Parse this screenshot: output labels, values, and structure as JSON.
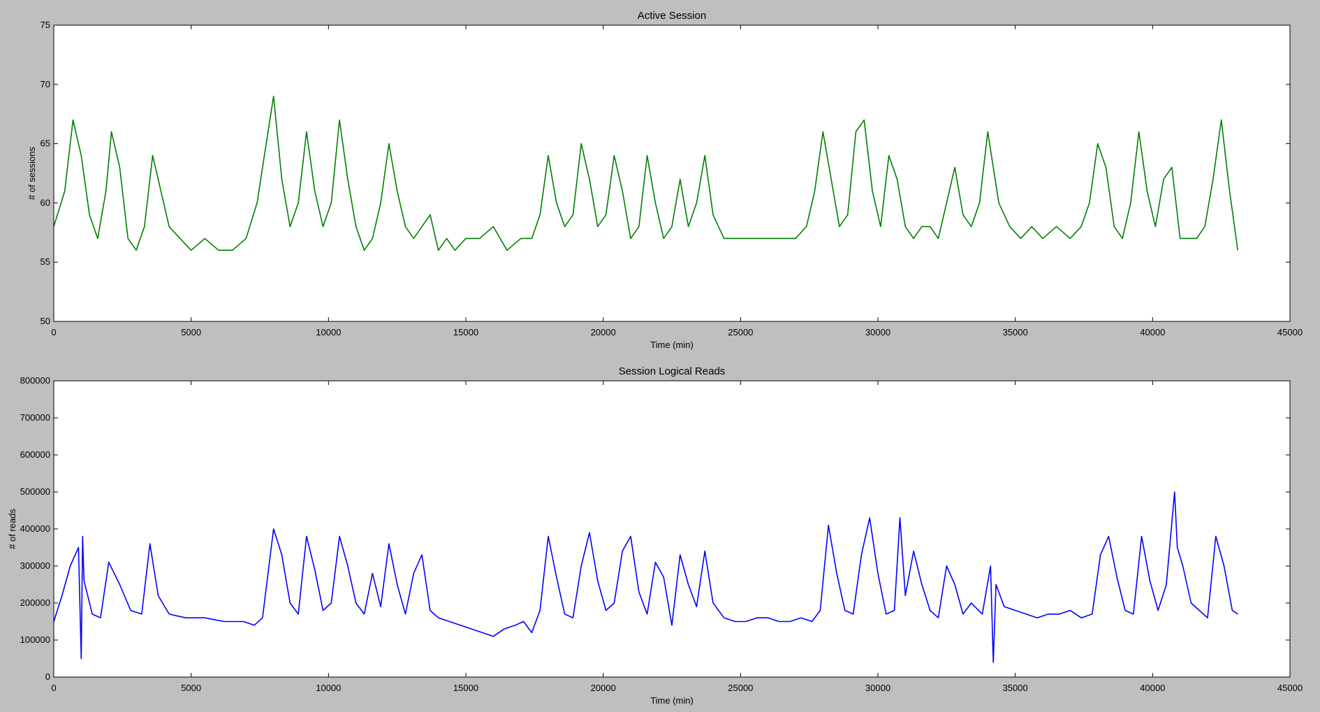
{
  "chart_data": [
    {
      "type": "line",
      "title": "Active Session",
      "xlabel": "Time (min)",
      "ylabel": "# of sessions",
      "xlim": [
        0,
        45000
      ],
      "ylim": [
        50,
        75
      ],
      "xticks": [
        "0",
        "5000",
        "10000",
        "15000",
        "20000",
        "25000",
        "30000",
        "35000",
        "40000",
        "45000"
      ],
      "yticks": [
        "50",
        "55",
        "60",
        "65",
        "70",
        "75"
      ],
      "grid": false,
      "series": [
        {
          "color": "#007f00",
          "x": [
            0,
            400,
            700,
            1000,
            1300,
            1600,
            1900,
            2100,
            2400,
            2700,
            3000,
            3300,
            3600,
            3900,
            4200,
            4600,
            5000,
            5500,
            6000,
            6500,
            7000,
            7400,
            7800,
            8000,
            8300,
            8600,
            8900,
            9200,
            9500,
            9800,
            10100,
            10400,
            10700,
            11000,
            11300,
            11600,
            11900,
            12200,
            12500,
            12800,
            13100,
            13400,
            13700,
            14000,
            14300,
            14600,
            15000,
            15500,
            16000,
            16500,
            17000,
            17400,
            17700,
            18000,
            18300,
            18600,
            18900,
            19200,
            19500,
            19800,
            20100,
            20400,
            20700,
            21000,
            21300,
            21600,
            21900,
            22200,
            22500,
            22800,
            23100,
            23400,
            23700,
            24000,
            24400,
            24800,
            25200,
            25600,
            26000,
            26500,
            27000,
            27400,
            27700,
            28000,
            28300,
            28600,
            28900,
            29200,
            29500,
            29800,
            30100,
            30400,
            30700,
            31000,
            31300,
            31600,
            31900,
            32200,
            32500,
            32800,
            33100,
            33400,
            33700,
            34000,
            34400,
            34800,
            35200,
            35600,
            36000,
            36500,
            37000,
            37400,
            37700,
            38000,
            38300,
            38600,
            38900,
            39200,
            39500,
            39800,
            40100,
            40400,
            40700,
            41000,
            41300,
            41600,
            41900,
            42200,
            42500,
            42800,
            43100
          ],
          "y": [
            58,
            61,
            67,
            64,
            59,
            57,
            61,
            66,
            63,
            57,
            56,
            58,
            64,
            61,
            58,
            57,
            56,
            57,
            56,
            56,
            57,
            60,
            66,
            69,
            62,
            58,
            60,
            66,
            61,
            58,
            60,
            67,
            62,
            58,
            56,
            57,
            60,
            65,
            61,
            58,
            57,
            58,
            59,
            56,
            57,
            56,
            57,
            57,
            58,
            56,
            57,
            57,
            59,
            64,
            60,
            58,
            59,
            65,
            62,
            58,
            59,
            64,
            61,
            57,
            58,
            64,
            60,
            57,
            58,
            62,
            58,
            60,
            64,
            59,
            57,
            57,
            57,
            57,
            57,
            57,
            57,
            58,
            61,
            66,
            62,
            58,
            59,
            66,
            67,
            61,
            58,
            64,
            62,
            58,
            57,
            58,
            58,
            57,
            60,
            63,
            59,
            58,
            60,
            66,
            60,
            58,
            57,
            58,
            57,
            58,
            57,
            58,
            60,
            65,
            63,
            58,
            57,
            60,
            66,
            61,
            58,
            62,
            63,
            57,
            57,
            57,
            58,
            62,
            67,
            61,
            56
          ]
        }
      ]
    },
    {
      "type": "line",
      "title": "Session Logical Reads",
      "xlabel": "Time (min)",
      "ylabel": "# of reads",
      "xlim": [
        0,
        45000
      ],
      "ylim": [
        0,
        800000
      ],
      "xticks": [
        "0",
        "5000",
        "10000",
        "15000",
        "20000",
        "25000",
        "30000",
        "35000",
        "40000",
        "45000"
      ],
      "yticks": [
        "0",
        "100000",
        "200000",
        "300000",
        "400000",
        "500000",
        "600000",
        "700000",
        "800000"
      ],
      "grid": false,
      "series": [
        {
          "color": "#0000ff",
          "x": [
            0,
            300,
            600,
            900,
            1000,
            1050,
            1100,
            1400,
            1700,
            2000,
            2400,
            2800,
            3200,
            3500,
            3800,
            4200,
            4800,
            5500,
            6200,
            6900,
            7300,
            7600,
            7800,
            8000,
            8300,
            8600,
            8900,
            9200,
            9500,
            9800,
            10100,
            10400,
            10700,
            11000,
            11300,
            11600,
            11900,
            12200,
            12500,
            12800,
            13100,
            13400,
            13700,
            14000,
            14400,
            14800,
            15200,
            15600,
            16000,
            16400,
            16800,
            17100,
            17400,
            17700,
            18000,
            18300,
            18600,
            18900,
            19200,
            19500,
            19800,
            20100,
            20400,
            20700,
            21000,
            21300,
            21600,
            21900,
            22200,
            22500,
            22800,
            23100,
            23400,
            23700,
            24000,
            24400,
            24800,
            25200,
            25600,
            26000,
            26400,
            26800,
            27200,
            27600,
            27900,
            28200,
            28500,
            28800,
            29100,
            29400,
            29700,
            30000,
            30300,
            30600,
            30800,
            31000,
            31300,
            31600,
            31900,
            32200,
            32500,
            32800,
            33100,
            33400,
            33800,
            34100,
            34200,
            34300,
            34600,
            35000,
            35400,
            35800,
            36200,
            36600,
            37000,
            37400,
            37800,
            38100,
            38400,
            38700,
            39000,
            39300,
            39600,
            39900,
            40200,
            40500,
            40800,
            40900,
            41100,
            41400,
            41700,
            42000,
            42300,
            42600,
            42900,
            43100
          ],
          "y": [
            150000,
            220000,
            300000,
            350000,
            50000,
            380000,
            260000,
            170000,
            160000,
            310000,
            250000,
            180000,
            170000,
            360000,
            220000,
            170000,
            160000,
            160000,
            150000,
            150000,
            140000,
            160000,
            280000,
            400000,
            330000,
            200000,
            170000,
            380000,
            290000,
            180000,
            200000,
            380000,
            300000,
            200000,
            170000,
            280000,
            190000,
            360000,
            250000,
            170000,
            280000,
            330000,
            180000,
            160000,
            150000,
            140000,
            130000,
            120000,
            110000,
            130000,
            140000,
            150000,
            120000,
            180000,
            380000,
            270000,
            170000,
            160000,
            300000,
            390000,
            260000,
            180000,
            200000,
            340000,
            380000,
            230000,
            170000,
            310000,
            270000,
            140000,
            330000,
            250000,
            190000,
            340000,
            200000,
            160000,
            150000,
            150000,
            160000,
            160000,
            150000,
            150000,
            160000,
            150000,
            180000,
            410000,
            280000,
            180000,
            170000,
            330000,
            430000,
            280000,
            170000,
            180000,
            430000,
            220000,
            340000,
            250000,
            180000,
            160000,
            300000,
            250000,
            170000,
            200000,
            170000,
            300000,
            40000,
            250000,
            190000,
            180000,
            170000,
            160000,
            170000,
            170000,
            180000,
            160000,
            170000,
            330000,
            380000,
            270000,
            180000,
            170000,
            380000,
            260000,
            180000,
            250000,
            500000,
            350000,
            300000,
            200000,
            180000,
            160000,
            380000,
            300000,
            180000,
            170000
          ]
        }
      ]
    }
  ]
}
